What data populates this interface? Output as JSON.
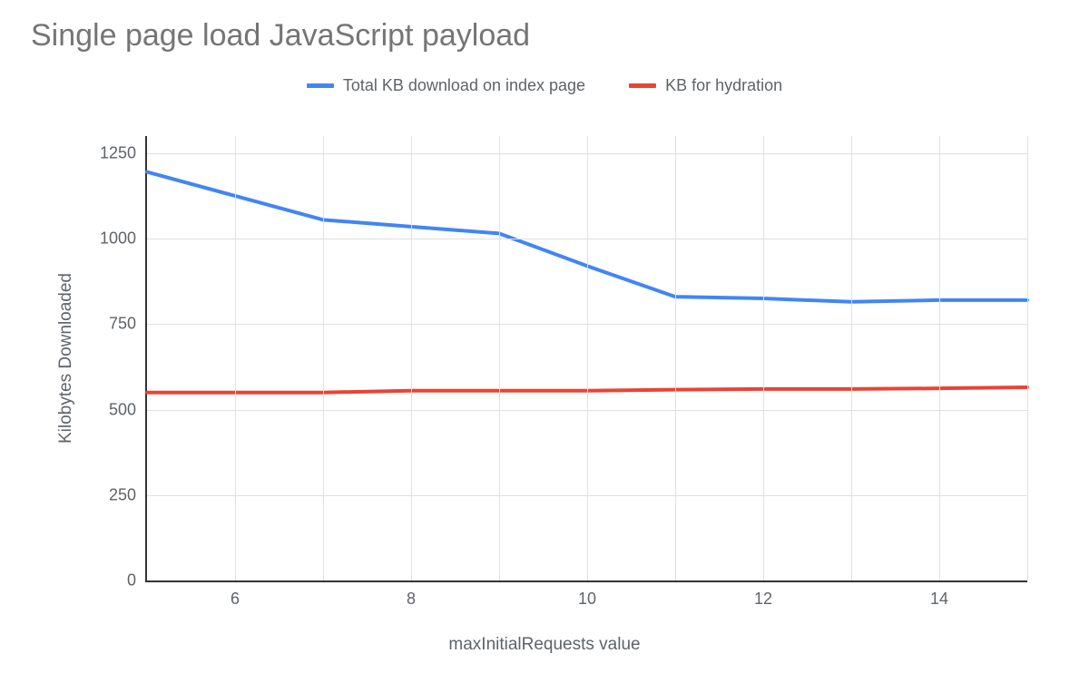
{
  "chart_data": {
    "type": "line",
    "title": "Single page load JavaScript payload",
    "xlabel": "maxInitialRequests value",
    "ylabel": "Kilobytes Downloaded",
    "xlim": [
      5,
      15
    ],
    "ylim": [
      0,
      1300
    ],
    "x_ticks": [
      6,
      8,
      10,
      12,
      14
    ],
    "y_ticks": [
      0,
      250,
      500,
      750,
      1000,
      1250
    ],
    "x": [
      5,
      6,
      7,
      8,
      9,
      10,
      11,
      12,
      13,
      14,
      15
    ],
    "series": [
      {
        "name": "Total KB download on index page",
        "color": "#4285f4",
        "values": [
          1195,
          1125,
          1055,
          1035,
          1015,
          920,
          830,
          825,
          815,
          820,
          820
        ]
      },
      {
        "name": "KB for hydration",
        "color": "#ea4335",
        "values": [
          550,
          550,
          550,
          555,
          555,
          555,
          558,
          560,
          560,
          562,
          565
        ]
      }
    ]
  }
}
